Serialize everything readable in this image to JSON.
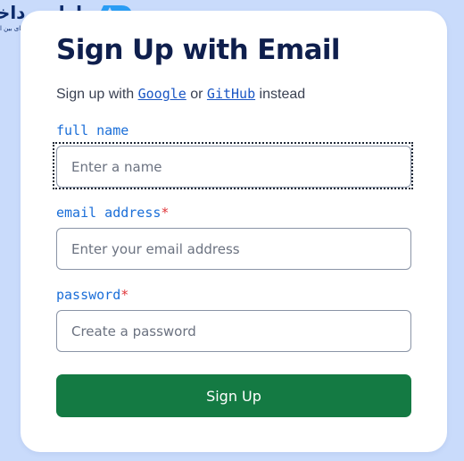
{
  "brand": {
    "name": "اول پرداخت",
    "tagline": "انتخاب اول در پرداخت‌های بین المللی",
    "mark_color": "#2a9df4",
    "name_color": "#0c2b6b",
    "logo_icon": "ap-monogram-icon"
  },
  "form": {
    "title": "Sign Up with Email",
    "subtitle": {
      "prefix": "Sign up with ",
      "google_link": "Google",
      "connector": " or ",
      "github_link": "GitHub",
      "suffix": " instead"
    },
    "fields": {
      "name": {
        "label": "full name",
        "placeholder": "Enter a name",
        "value": "",
        "required": false
      },
      "email": {
        "label": "email address",
        "required_mark": "*",
        "placeholder": "Enter your email address",
        "value": "",
        "required": true
      },
      "password": {
        "label": "password",
        "required_mark": "*",
        "placeholder": "Create a password",
        "value": "",
        "required": true
      }
    },
    "submit_label": "Sign Up"
  },
  "colors": {
    "background": "#c9dbfb",
    "card": "#ffffff",
    "title": "#0f1f4d",
    "label": "#1a6ed8",
    "link": "#1a56c4",
    "required": "#e0363a",
    "button": "#147a43",
    "button_text": "#ffffff"
  }
}
